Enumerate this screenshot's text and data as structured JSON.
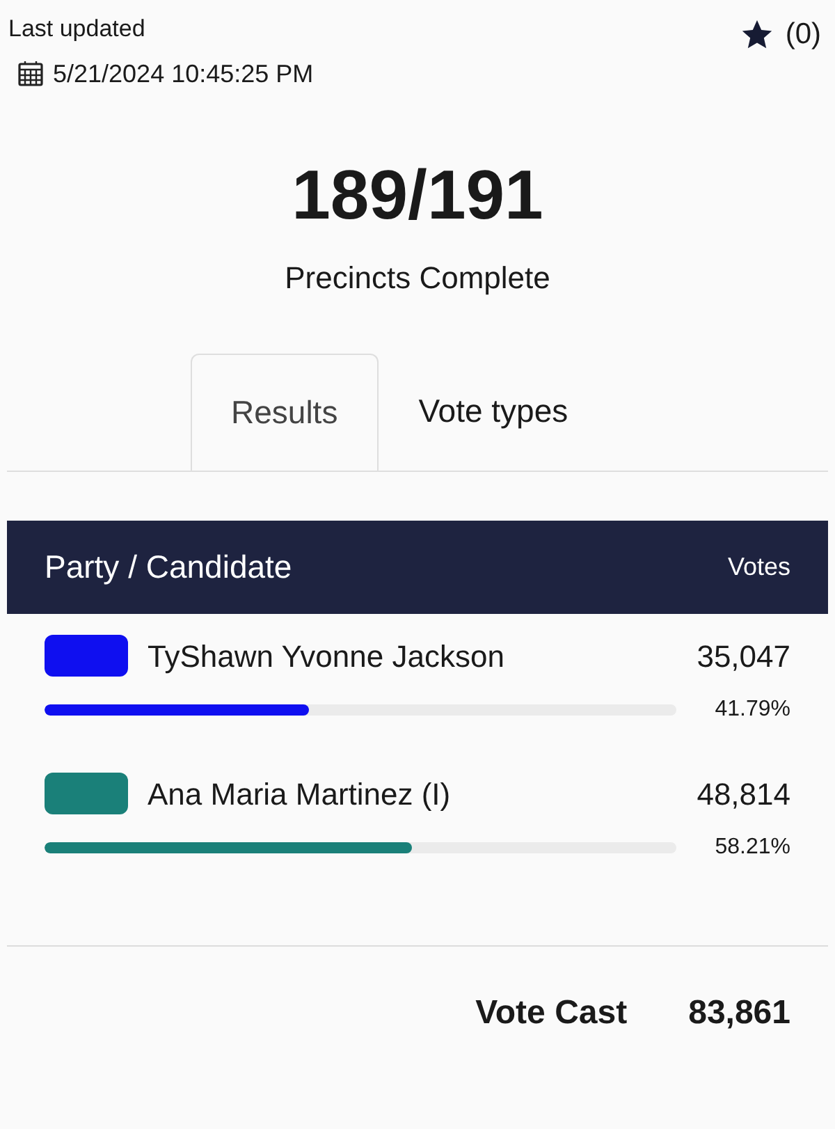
{
  "last_updated": {
    "label": "Last updated",
    "timestamp": "5/21/2024 10:45:25 PM"
  },
  "favorite": {
    "count": "(0)"
  },
  "precincts": {
    "value": "189/191",
    "label": "Precincts Complete"
  },
  "tabs": [
    {
      "label": "Results",
      "selected": true
    },
    {
      "label": "Vote types",
      "selected": false
    }
  ],
  "table": {
    "columns": [
      "Party / Candidate",
      "Votes"
    ],
    "rows": [
      {
        "name": "TyShawn Yvonne Jackson",
        "color": "#0f0ff0",
        "votes": "35,047",
        "level": 0.4179,
        "percent": "41.79%"
      },
      {
        "name": "Ana Maria Martinez (I)",
        "color": "#1a8079",
        "votes": "48,814",
        "level": 0.5821,
        "percent": "58.21%"
      }
    ]
  },
  "total": {
    "label": "Vote Cast",
    "value": "83,861"
  }
}
